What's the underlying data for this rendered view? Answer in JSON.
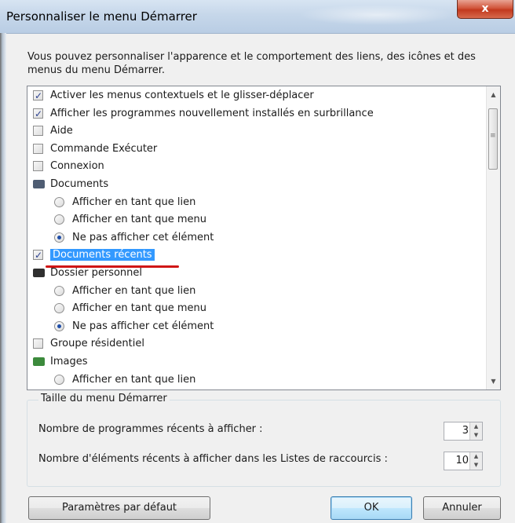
{
  "window": {
    "title": "Personnaliser le menu Démarrer",
    "close_label": "x"
  },
  "intro_text": "Vous pouvez personnaliser l'apparence et le comportement des liens, des icônes et des menus du menu Démarrer.",
  "options": [
    {
      "label": "Activer les menus contextuels et le glisser-déplacer",
      "type": "checkbox",
      "checked": true
    },
    {
      "label": "Afficher les programmes nouvellement installés en surbrillance",
      "type": "checkbox",
      "checked": true
    },
    {
      "label": "Aide",
      "type": "checkbox",
      "checked": false
    },
    {
      "label": "Commande Exécuter",
      "type": "checkbox",
      "checked": false
    },
    {
      "label": "Connexion",
      "type": "checkbox",
      "checked": false
    },
    {
      "label": "Documents",
      "type": "header",
      "icon": "documents-icon"
    },
    {
      "label": "Afficher en tant que lien",
      "type": "radio",
      "checked": false
    },
    {
      "label": "Afficher en tant que menu",
      "type": "radio",
      "checked": false
    },
    {
      "label": "Ne pas afficher cet élément",
      "type": "radio",
      "checked": true
    },
    {
      "label": "Documents récents",
      "type": "checkbox",
      "checked": true,
      "selected": true
    },
    {
      "label": "Dossier personnel",
      "type": "header",
      "icon": "personal-folder-icon"
    },
    {
      "label": "Afficher en tant que lien",
      "type": "radio",
      "checked": false
    },
    {
      "label": "Afficher en tant que menu",
      "type": "radio",
      "checked": false
    },
    {
      "label": "Ne pas afficher cet élément",
      "type": "radio",
      "checked": true
    },
    {
      "label": "Groupe résidentiel",
      "type": "checkbox",
      "checked": false
    },
    {
      "label": "Images",
      "type": "header",
      "icon": "images-icon"
    },
    {
      "label": "Afficher en tant que lien",
      "type": "radio",
      "checked": false
    }
  ],
  "menu_size": {
    "legend": "Taille du menu Démarrer",
    "recent_programs_label": "Nombre de programmes récents à afficher :",
    "recent_programs_value": "3",
    "jump_list_label": "Nombre d'éléments récents à afficher dans les Listes de raccourcis :",
    "jump_list_value": "10"
  },
  "buttons": {
    "defaults": "Paramètres par défaut",
    "ok": "OK",
    "cancel": "Annuler"
  },
  "colors": {
    "selection": "#3399ff",
    "annotation_underline": "#d01616",
    "radio_dot": "#1f4ea8"
  }
}
